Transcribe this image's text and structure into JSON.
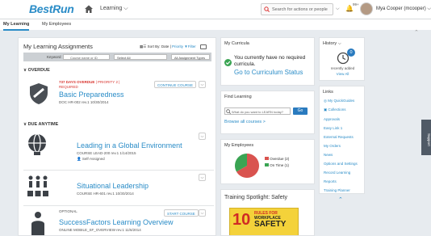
{
  "header": {
    "logo": "BestRun",
    "learning_menu": "Learning",
    "search_placeholder": "Search for actions or people",
    "notifications_count": "99+",
    "user_name": "Mya Cooper (mcooper)"
  },
  "tabs": [
    "My Learning",
    "My Employees"
  ],
  "assignments": {
    "title": "My Learning Assignments",
    "sort_label": "Sort By: Date",
    "priority_link": "Priority",
    "filter_link": "Filter",
    "keyword_label": "Keyword",
    "search_placeholder": "Course name or ID",
    "status_select": "Select All",
    "type_select": "All Assignment Types",
    "overdue_header": "OVERDUE",
    "due_anytime_header": "DUE ANYTIME",
    "items": [
      {
        "warning": "737 DAYS OVERDUE",
        "priority": "PRIORITY 2",
        "required": "REQUIRED",
        "title": "Basic Preparedness",
        "meta": "DOC HR-002 rev.1 10/30/2014",
        "action": "CONTINUE COURSE"
      },
      {
        "title": "Leading in a Global Environment",
        "meta": "COURSE LEAD-200 rev.1 1/14/2015",
        "note": "Self-Assigned"
      },
      {
        "title": "Situational Leadership",
        "meta": "COURSE HR-601 rev.1 10/30/2014"
      },
      {
        "label": "OPTIONAL",
        "title": "SuccessFactors Learning Overview",
        "meta": "ONLINE MOBILE_SF_OVERVIEW rev.1 11/6/2014",
        "action": "START COURSE"
      }
    ]
  },
  "curricula": {
    "title": "My Curricula",
    "message": "You currently have no required curricula.",
    "link": "Go to Curriculum Status"
  },
  "find": {
    "title": "Find Learning",
    "placeholder": "What do you want to LEARN today?",
    "button": "Go",
    "browse": "Browse all courses >"
  },
  "employees": {
    "title": "My Employees",
    "legend": [
      {
        "label": "Overdue (2)",
        "color": "#d9534f"
      },
      {
        "label": "On Time (1)",
        "color": "#3aa453"
      }
    ]
  },
  "spotlight": {
    "title": "Training Spotlight: Safety",
    "poster_l1": "RULES FOR",
    "poster_l2": "WORKPLACE",
    "poster_l3": "SAFETY",
    "poster_num": "10"
  },
  "history": {
    "title": "History",
    "count": "0",
    "note": "recently added",
    "view_all": "View All"
  },
  "links": {
    "title": "Links",
    "items": [
      "My QuickGuides",
      "Collections",
      "Approvals",
      "Easy Link 1",
      "External Requests",
      "My Orders",
      "News",
      "Options and Settings",
      "Record Learning",
      "Reports",
      "Training Planner"
    ]
  },
  "support": "Support"
}
